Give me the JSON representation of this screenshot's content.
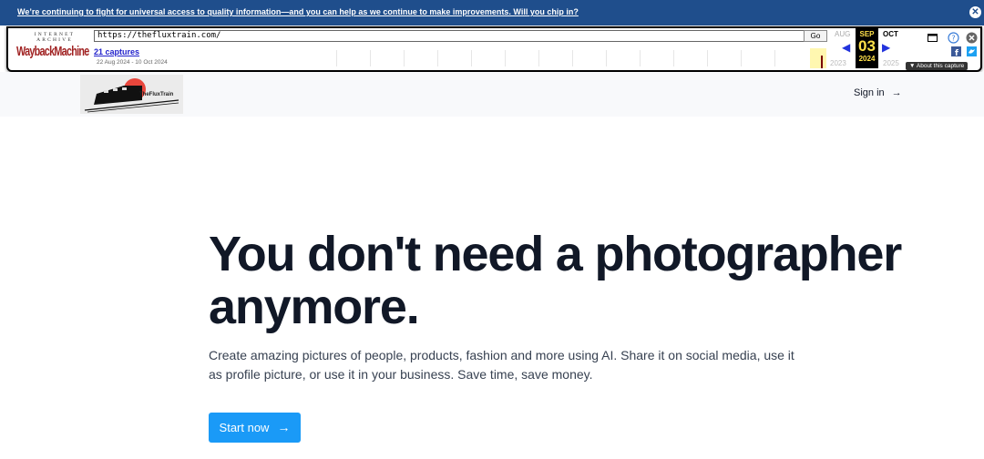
{
  "donation_banner": {
    "text": "We’re continuing to fight for universal access to quality information—and you can help as we continue to make improvements. Will you chip in?",
    "close_glyph": "✕"
  },
  "wayback": {
    "logo_top": "INTERNET ARCHIVE",
    "logo_main": "WaybackMachine",
    "url_value": "https://thefluxtrain.com/",
    "go_label": "Go",
    "captures_link": "21 captures",
    "date_range": "22 Aug 2024 - 10 Oct 2024",
    "prev_month": "AUG",
    "current_month": "SEP",
    "current_day": "03",
    "current_year": "2024",
    "next_month": "OCT",
    "prev_year": "2023",
    "next_year": "2025",
    "about_label": "▼ About this capture",
    "prev_arrow": "◀",
    "next_arrow": "▶"
  },
  "header": {
    "logo_text": "TheFluxTrain",
    "signin_label": "Sign in",
    "signin_arrow": "→"
  },
  "hero": {
    "title": "You don't need a photographer anymore.",
    "subtitle": "Create amazing pictures of people, products, fashion and more using AI. Share it on social media, use it as profile picture, or use it in your business. Save time, save money.",
    "cta_label": "Start now",
    "cta_arrow": "→"
  },
  "colors": {
    "banner_bg": "#1f4e8c",
    "cta_bg": "#1a9af7",
    "title_text": "#111827",
    "header_bg": "#f8f9fb"
  },
  "icons": {
    "banner_close": "close-icon",
    "window": "window-icon",
    "help": "help-icon",
    "close": "close-circle-icon",
    "facebook": "facebook-icon",
    "twitter": "twitter-icon",
    "arrow": "arrow-right-icon"
  }
}
